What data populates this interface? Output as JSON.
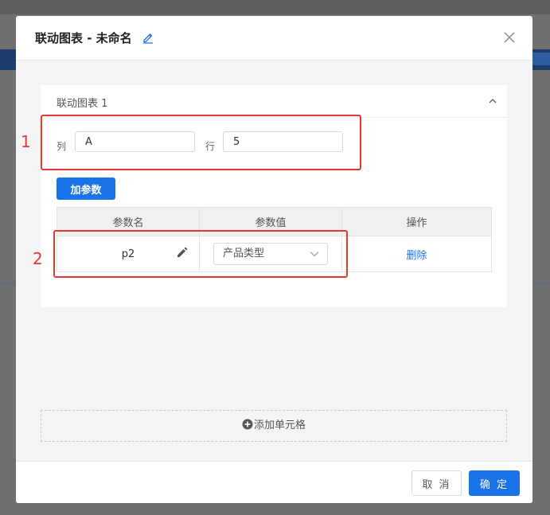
{
  "modal": {
    "title": "联动图表 - 未命名",
    "icons": {
      "edit_title": "pencil-icon",
      "close": "close-icon"
    }
  },
  "panel": {
    "title": "联动图表 1",
    "collapse_icon": "chevron-up-icon",
    "column_label": "列",
    "column_value": "A",
    "row_label": "行",
    "row_value": "5",
    "add_param_label": "加参数"
  },
  "table": {
    "headers": [
      "参数名",
      "参数值",
      "操作"
    ],
    "rows": [
      {
        "name": "p2",
        "value": "产品类型",
        "action": "删除"
      }
    ]
  },
  "annotations": {
    "box1": "1",
    "box2": "2"
  },
  "add_cell_label": "添加单元格",
  "footer": {
    "cancel_label": "取 消",
    "ok_label": "确 定"
  },
  "colors": {
    "primary": "#1a73e8",
    "annotation": "#e53935"
  }
}
